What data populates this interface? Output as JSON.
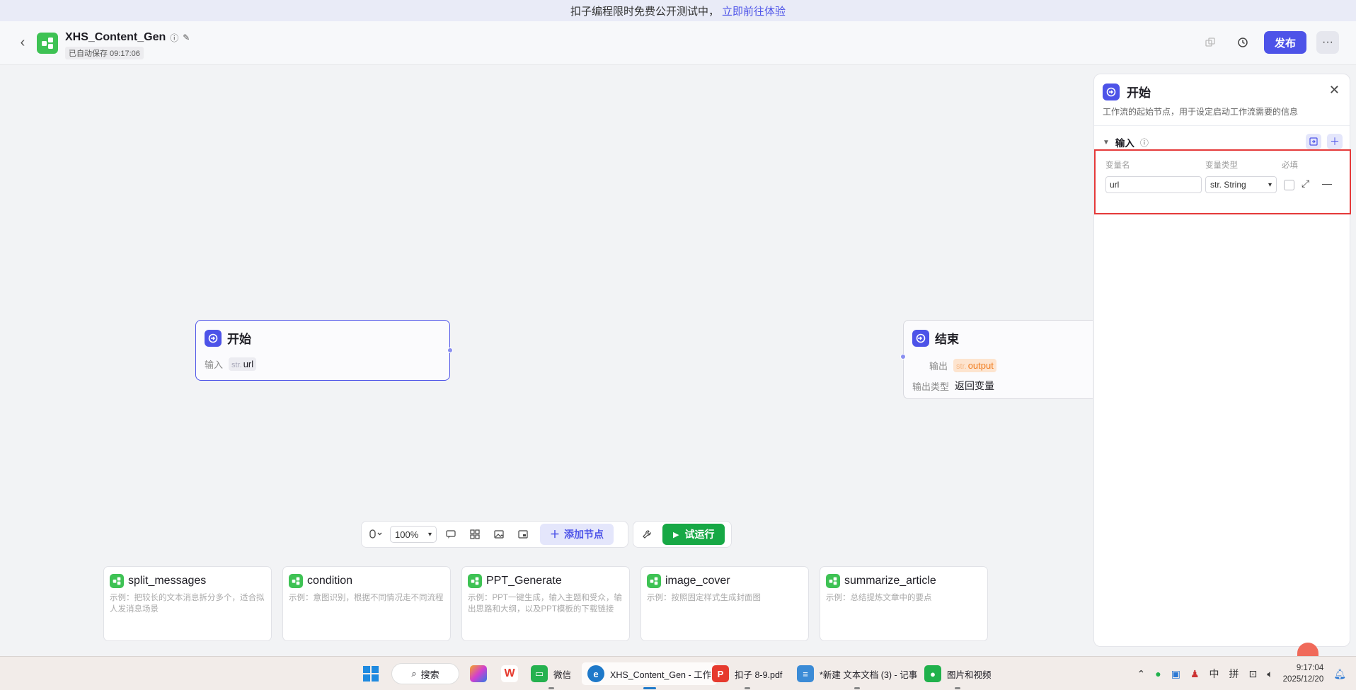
{
  "banner": {
    "text": "扣子编程限时免费公开测试中，",
    "link": "立即前往体验"
  },
  "header": {
    "title": "XHS_Content_Gen",
    "saved_status": "已自动保存 09:17:06",
    "publish_label": "发布",
    "more_label": "···"
  },
  "nodes": {
    "start": {
      "title": "开始",
      "input_label": "输入",
      "var_prefix": "str.",
      "var_name": "url"
    },
    "end": {
      "title": "结束",
      "output_label": "输出",
      "var_prefix": "str.",
      "var_name": "output",
      "output_type_label": "输出类型",
      "output_type_value": "返回变量"
    }
  },
  "toolbar": {
    "zoom": "100%",
    "add_node_label": "添加节点",
    "run_label": "试运行"
  },
  "templates": [
    {
      "name": "split_messages",
      "desc": "示例：把较长的文本消息拆分多个，适合拟人发消息场景"
    },
    {
      "name": "condition",
      "desc": "示例：意图识别，根据不同情况走不同流程"
    },
    {
      "name": "PPT_Generate",
      "desc": "示例：PPT一键生成，输入主题和受众，输出思路和大纲，以及PPT模板的下载链接"
    },
    {
      "name": "image_cover",
      "desc": "示例：按照固定样式生成封面图"
    },
    {
      "name": "summarize_article",
      "desc": "示例：总结提炼文章中的要点"
    }
  ],
  "panel": {
    "title": "开始",
    "description": "工作流的起始节点，用于设定启动工作流需要的信息",
    "section_label": "输入",
    "col_name": "变量名",
    "col_type": "变量类型",
    "col_required": "必填",
    "var_value": "url",
    "var_type": "str. String"
  },
  "taskbar": {
    "search_label": "搜索",
    "apps": [
      {
        "label": "微信"
      },
      {
        "label": "XHS_Content_Gen - 工作"
      },
      {
        "label": "扣子 8-9.pdf"
      },
      {
        "label": "*新建 文本文档 (3) - 记事"
      },
      {
        "label": "图片和视频"
      }
    ],
    "ime_lang": "中",
    "ime_mode": "拼",
    "time": "9:17:04",
    "date": "2025/12/20"
  },
  "colors": {
    "accent": "#4d53e8",
    "green": "#17a845",
    "highlight_border": "#e53a3a"
  }
}
